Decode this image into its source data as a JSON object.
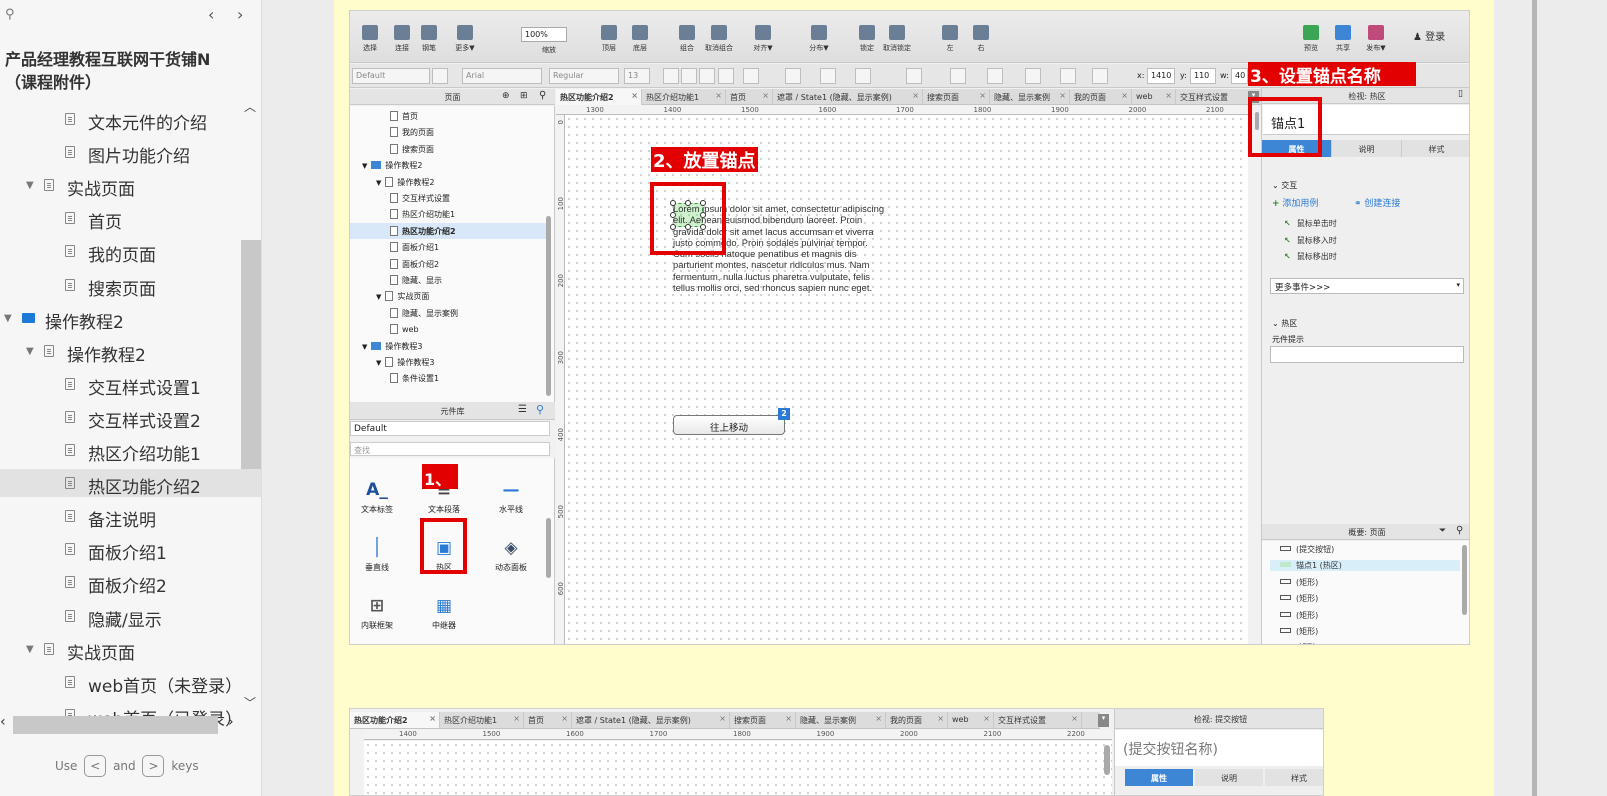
{
  "sidebar": {
    "title": "产品经理教程互联网干货铺N（课程附件）",
    "items": [
      {
        "label": "文本元件的介绍",
        "type": "page"
      },
      {
        "label": "图片功能介绍",
        "type": "page"
      },
      {
        "label": "实战页面",
        "type": "group"
      },
      {
        "label": "首页",
        "type": "page"
      },
      {
        "label": "我的页面",
        "type": "page"
      },
      {
        "label": "搜索页面",
        "type": "page"
      },
      {
        "label": "操作教程2",
        "type": "folder"
      },
      {
        "label": "操作教程2",
        "type": "group"
      },
      {
        "label": "交互样式设置1",
        "type": "page"
      },
      {
        "label": "交互样式设置2",
        "type": "page"
      },
      {
        "label": "热区介绍功能1",
        "type": "page"
      },
      {
        "label": "热区功能介绍2",
        "type": "page",
        "selected": true
      },
      {
        "label": "备注说明",
        "type": "page"
      },
      {
        "label": "面板介绍1",
        "type": "page"
      },
      {
        "label": "面板介绍2",
        "type": "page"
      },
      {
        "label": "隐藏/显示",
        "type": "page"
      },
      {
        "label": "实战页面",
        "type": "group"
      },
      {
        "label": "web首页（未登录）",
        "type": "page"
      },
      {
        "label": "web首页（已登录）",
        "type": "page"
      }
    ],
    "hint_use": "Use",
    "hint_and": "and",
    "hint_keys": "keys",
    "key_left": "<",
    "key_right": ">"
  },
  "toolbar": {
    "items": [
      "选择",
      "连接",
      "钢笔",
      "更多▼",
      "缩放",
      "顶层",
      "底层",
      "组合",
      "取消组合",
      "对齐▼",
      "分布▼",
      "锁定",
      "取消锁定",
      "左",
      "右"
    ],
    "right_items": [
      "预览",
      "共享",
      "发布▼"
    ],
    "zoom": "100%",
    "login": "登录"
  },
  "format_bar": {
    "style": "Default",
    "font": "Arial",
    "weight": "Regular",
    "size": "13",
    "x_label": "x:",
    "x": "1410",
    "y_label": "y:",
    "y": "110",
    "w_label": "w:",
    "w": "40"
  },
  "pages_panel": {
    "title": "页面",
    "tree": [
      {
        "label": "首页",
        "level": 3,
        "kind": "page"
      },
      {
        "label": "我的页面",
        "level": 3,
        "kind": "page"
      },
      {
        "label": "搜索页面",
        "level": 3,
        "kind": "page"
      },
      {
        "label": "操作教程2",
        "level": 1,
        "kind": "folder"
      },
      {
        "label": "操作教程2",
        "level": 2,
        "kind": "page"
      },
      {
        "label": "交互样式设置",
        "level": 3,
        "kind": "page"
      },
      {
        "label": "热区介绍功能1",
        "level": 3,
        "kind": "page"
      },
      {
        "label": "热区功能介绍2",
        "level": 3,
        "kind": "page",
        "selected": true
      },
      {
        "label": "面板介绍1",
        "level": 3,
        "kind": "page"
      },
      {
        "label": "面板介绍2",
        "level": 3,
        "kind": "page"
      },
      {
        "label": "隐藏、显示",
        "level": 3,
        "kind": "page"
      },
      {
        "label": "实战页面",
        "level": 2,
        "kind": "page"
      },
      {
        "label": "隐藏、显示案例",
        "level": 3,
        "kind": "page"
      },
      {
        "label": "web",
        "level": 3,
        "kind": "page"
      },
      {
        "label": "操作教程3",
        "level": 1,
        "kind": "folder"
      },
      {
        "label": "操作教程3",
        "level": 2,
        "kind": "page"
      },
      {
        "label": "条件设置1",
        "level": 3,
        "kind": "page"
      }
    ]
  },
  "library": {
    "title": "元件库",
    "selected": "Default",
    "search": "查找",
    "items": [
      "文本标签",
      "文本段落",
      "水平线",
      "垂直线",
      "热区",
      "动态面板",
      "内联框架",
      "中继器"
    ]
  },
  "tabs": [
    "热区功能介绍2",
    "热区介绍功能1",
    "首页",
    "遮罩 / State1 (隐藏、显示案例)",
    "搜索页面",
    "隐藏、显示案例",
    "我的页面",
    "web",
    "交互样式设置"
  ],
  "ruler_top": [
    "1300",
    "1400",
    "1500",
    "1600",
    "1700",
    "1800",
    "1900",
    "2000",
    "2100"
  ],
  "ruler_left": [
    "0",
    "100",
    "200",
    "300",
    "400",
    "500",
    "600"
  ],
  "canvas": {
    "lorem": [
      "Lorem ipsum dolor sit amet, consectetur adipiscing",
      "elit. Aenean euismod bibendum laoreet. Proin",
      "gravida dolor sit amet lacus accumsan et viverra",
      "justo commodo. Proin sodales pulvinar tempor.",
      "Cum sociis natoque penatibus et magnis dis",
      "parturient montes, nascetur ridiculus mus. Nam",
      "fermentum, nulla luctus pharetra vulputate, felis",
      "tellus mollis orci, sed rhoncus sapien nunc eget."
    ],
    "button": "往上移动",
    "badge": "2"
  },
  "annotations": {
    "step1": "1、",
    "step2": "2、放置锚点",
    "step3": "3、设置锚点名称"
  },
  "inspector": {
    "title": "检视: 热区",
    "name": "锚点1",
    "tabs": [
      "属性",
      "说明",
      "样式"
    ],
    "interaction": "交互",
    "add_case": "添加用例",
    "create_link": "创建连接",
    "events": [
      "鼠标单击时",
      "鼠标移入时",
      "鼠标移出时"
    ],
    "more_events": "更多事件>>>",
    "hotspot": "热区",
    "tooltip": "元件提示"
  },
  "outline": {
    "title": "概要: 页面",
    "rows": [
      "(提交按钮)",
      "锚点1 (热区)",
      "(矩形)",
      "(矩形)",
      "(矩形)",
      "(矩形)",
      "(矩形)"
    ]
  },
  "second": {
    "tabs": [
      "热区功能介绍2",
      "热区介绍功能1",
      "首页",
      "遮罩 / State1 (隐藏、显示案例)",
      "搜索页面",
      "隐藏、显示案例",
      "我的页面",
      "web",
      "交互样式设置"
    ],
    "ruler": [
      "1400",
      "1500",
      "1600",
      "1700",
      "1800",
      "1900",
      "2000",
      "2100",
      "2200"
    ],
    "inspector_title": "检视: 提交按钮",
    "name": "(提交按钮名称)",
    "insp_tabs": [
      "属性",
      "说明",
      "样式"
    ]
  }
}
